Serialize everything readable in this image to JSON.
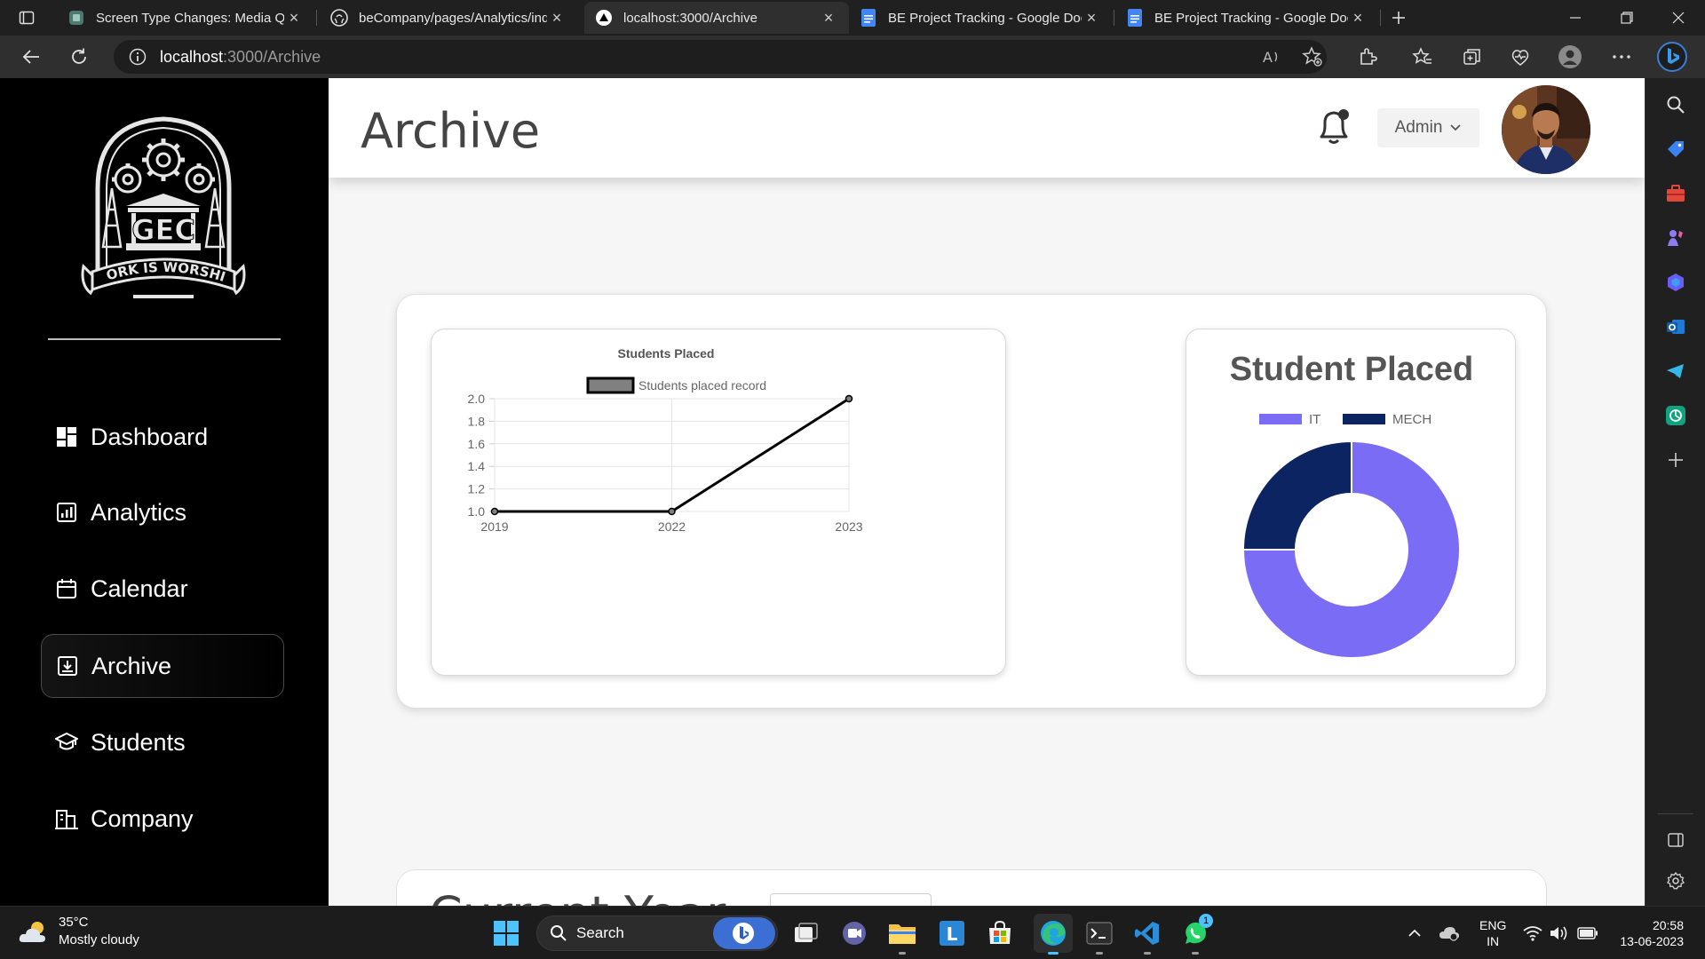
{
  "browser": {
    "tabs": [
      {
        "title": "Screen Type Changes: Media Qu",
        "icon": "screen-type-favicon"
      },
      {
        "title": "beCompany/pages/Analytics/ind",
        "icon": "github-icon"
      },
      {
        "title": "localhost:3000/Archive",
        "icon": "app-triangle-favicon",
        "active": true
      },
      {
        "title": "BE Project Tracking - Google Doc",
        "icon": "google-docs-icon"
      },
      {
        "title": "BE Project Tracking - Google Doc",
        "icon": "google-docs-icon"
      }
    ],
    "url_host": "localhost",
    "url_path": ":3000/Archive"
  },
  "sidebar": {
    "logo": {
      "emblem_text": "GEC",
      "motto": "WORK IS WORSHIP"
    },
    "items": [
      {
        "label": "Dashboard",
        "icon": "dashboard-icon"
      },
      {
        "label": "Analytics",
        "icon": "analytics-icon"
      },
      {
        "label": "Calendar",
        "icon": "calendar-icon"
      },
      {
        "label": "Archive",
        "icon": "archive-icon",
        "active": true
      },
      {
        "label": "Students",
        "icon": "graduation-cap-icon"
      },
      {
        "label": "Company",
        "icon": "company-building-icon"
      }
    ]
  },
  "header": {
    "title": "Archive",
    "role": "Admin"
  },
  "colors": {
    "sidebar_bg": "#000000",
    "it": "#7B6CF6",
    "mech": "#0C2461",
    "line": "#000000",
    "legend_box": "#808080"
  },
  "chart_data": [
    {
      "type": "line",
      "title": "Students Placed",
      "x": [
        "2019",
        "2022",
        "2023"
      ],
      "series": [
        {
          "name": "Students placed record",
          "values": [
            1,
            1,
            2
          ]
        }
      ],
      "ylim": [
        1,
        2
      ],
      "yticks": [
        "1.0",
        "1.2",
        "1.4",
        "1.6",
        "1.8",
        "2.0"
      ],
      "grid": true,
      "legend": "top"
    },
    {
      "type": "pie",
      "donut": true,
      "title": "Student Placed",
      "categories": [
        "IT",
        "MECH"
      ],
      "values": [
        3,
        1
      ],
      "legend": "top"
    }
  ],
  "current_section": {
    "title": "Current Year"
  },
  "taskbar": {
    "weather_temp": "35°C",
    "weather_desc": "Mostly cloudy",
    "search_label": "Search",
    "whatsapp_badge": "1",
    "lang": "ENG",
    "region": "IN",
    "time": "20:58",
    "date": "13-06-2023"
  }
}
